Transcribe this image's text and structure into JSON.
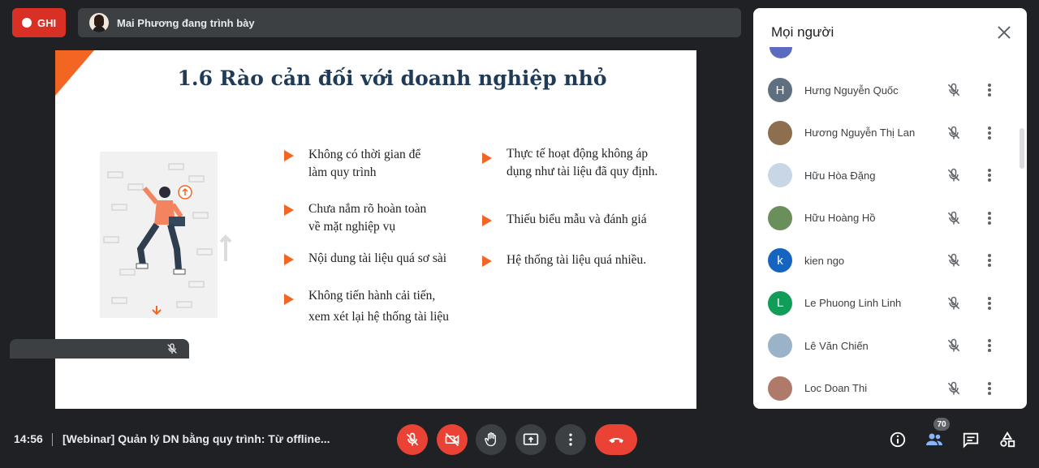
{
  "recording": {
    "label": "GHI"
  },
  "presenting": {
    "text": "Mai Phương đang trình bày"
  },
  "slide": {
    "title": "1.6 Rào cản đối với doanh nghiệp nhỏ",
    "bullets_left": [
      "Không có thời gian để\nlàm quy trình",
      "Chưa nắm rõ hoàn toàn\nvề mặt nghiệp vụ",
      "Nội dung tài liệu quá sơ sài",
      "Không tiến hành cải tiến,\nxem xét lại hệ thống tài liệu"
    ],
    "bullets_right": [
      "Thực tế hoạt động không áp\ndụng như tài liệu đã quy định.",
      "Thiếu biểu mẫu và đánh giá",
      "Hệ thống tài liệu quá nhiều."
    ]
  },
  "people_panel": {
    "title": "Mọi người",
    "participants": [
      {
        "name": "Hưng Nguyễn Quốc",
        "initial": "H",
        "avatar_color": "#5f6f80"
      },
      {
        "name": "Hương Nguyễn Thị Lan",
        "initial": "",
        "avatar_color": "#8d6e4e"
      },
      {
        "name": "Hữu Hòa Đặng",
        "initial": "",
        "avatar_color": "#c9d6e6"
      },
      {
        "name": "Hữu Hoàng Hồ",
        "initial": "",
        "avatar_color": "#6b8f5a"
      },
      {
        "name": "kien ngo",
        "initial": "k",
        "avatar_color": "#1565c0"
      },
      {
        "name": "Le Phuong Linh Linh",
        "initial": "L",
        "avatar_color": "#0f9d58"
      },
      {
        "name": "Lê Văn Chiến",
        "initial": "",
        "avatar_color": "#9bb3c9"
      },
      {
        "name": "Loc Doan Thi",
        "initial": "",
        "avatar_color": "#b07a6a"
      }
    ]
  },
  "bottom_bar": {
    "time": "14:56",
    "meeting_title": "[Webinar] Quản lý DN bằng quy trình: Từ offline...",
    "participant_count": "70"
  }
}
